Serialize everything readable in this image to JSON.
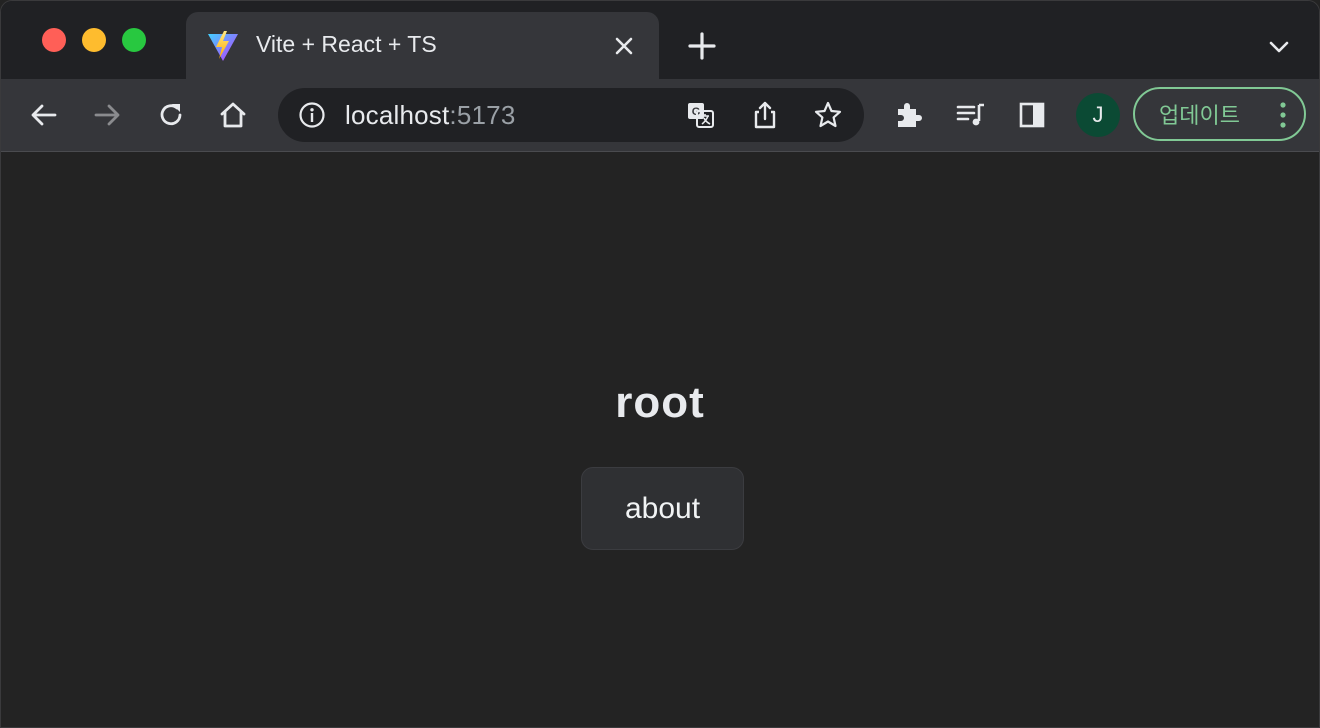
{
  "window": {
    "controls": [
      "close",
      "minimize",
      "zoom"
    ]
  },
  "tab": {
    "title": "Vite + React + TS",
    "favicon": "vite-logo-icon"
  },
  "toolbar": {
    "url_host": "localhost",
    "url_port": ":5173",
    "avatar_letter": "J",
    "update_label": "업데이트"
  },
  "page": {
    "heading": "root",
    "about_label": "about"
  },
  "colors": {
    "page_bg": "#232323",
    "toolbar_bg": "#35363a",
    "tabstrip_bg": "#202124",
    "accent_green": "#81c995",
    "avatar_bg": "#0b4a34"
  }
}
